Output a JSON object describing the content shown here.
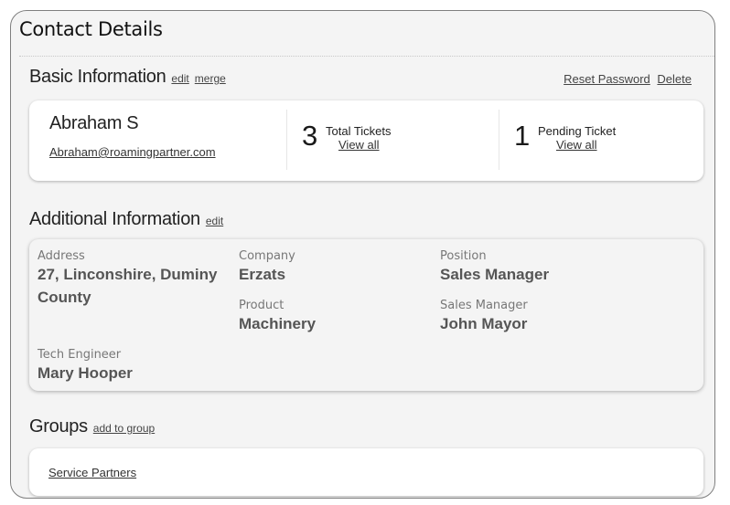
{
  "panel": {
    "title": "Contact Details"
  },
  "basic": {
    "heading": "Basic Information",
    "links": {
      "edit": "edit",
      "merge": "merge"
    },
    "actions": {
      "reset_password": "Reset Password",
      "delete": "Delete"
    },
    "contact": {
      "name": "Abraham S",
      "email": "Abraham@roamingpartner.com"
    },
    "stats": [
      {
        "count": "3",
        "label": "Total Tickets",
        "link": "View all"
      },
      {
        "count": "1",
        "label": "Pending Ticket",
        "link": "View all"
      }
    ]
  },
  "additional": {
    "heading": "Additional Information",
    "edit": "edit",
    "fields": {
      "address": {
        "label": "Address",
        "value_line1": "27, Linconshire, Duminy",
        "value_line2": "County"
      },
      "company": {
        "label": "Company",
        "value": "Erzats"
      },
      "position": {
        "label": "Position",
        "value": "Sales Manager"
      },
      "product": {
        "label": "Product",
        "value": "Machinery"
      },
      "sales_manager": {
        "label": "Sales Manager",
        "value": "John Mayor"
      },
      "tech_engineer": {
        "label": "Tech Engineer",
        "value": "Mary Hooper"
      }
    }
  },
  "groups": {
    "heading": "Groups",
    "add": "add to group",
    "items": [
      "Service Partners"
    ]
  }
}
